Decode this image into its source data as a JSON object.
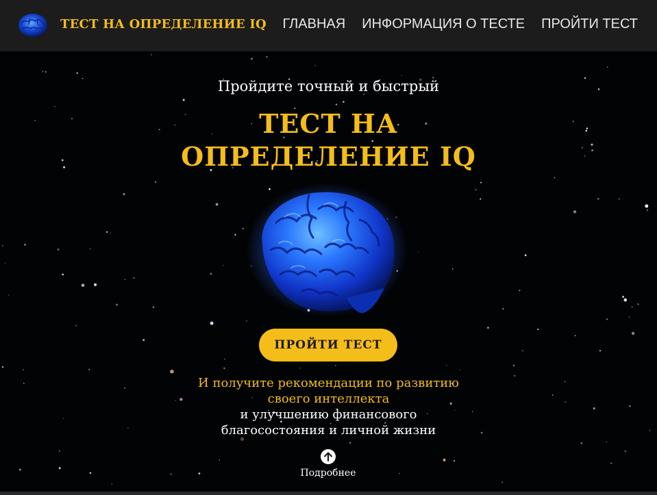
{
  "header": {
    "logo_icon": "brain-icon",
    "logo_text": "ТЕСТ НА ОПРЕДЕЛЕНИЕ IQ",
    "nav": [
      {
        "label": "ГЛАВНАЯ"
      },
      {
        "label": "ИНФОРМАЦИЯ О ТЕСТЕ"
      },
      {
        "label": "ПРОЙТИ ТЕСТ"
      }
    ]
  },
  "hero": {
    "subtitle": "Пройдите точный и быстрый",
    "title_line1": "ТЕСТ НА",
    "title_line2": "ОПРЕДЕЛЕНИЕ IQ",
    "image": "brain-image",
    "cta_label": "ПРОЙТИ ТЕСТ",
    "desc_gold_line1": "И получите рекомендации по развитию",
    "desc_gold_line2": "своего интеллекта",
    "desc_white_line1": "и улучшению финансового",
    "desc_white_line2": "благосостояния и личной жизни",
    "more_icon": "arrow-up-circle-icon",
    "more_label": "Подробнее"
  },
  "colors": {
    "accent": "#f4bd19",
    "header_bg": "#1c1c1c",
    "hero_bg": "#020305",
    "brain_blue": "#1a5cff"
  }
}
